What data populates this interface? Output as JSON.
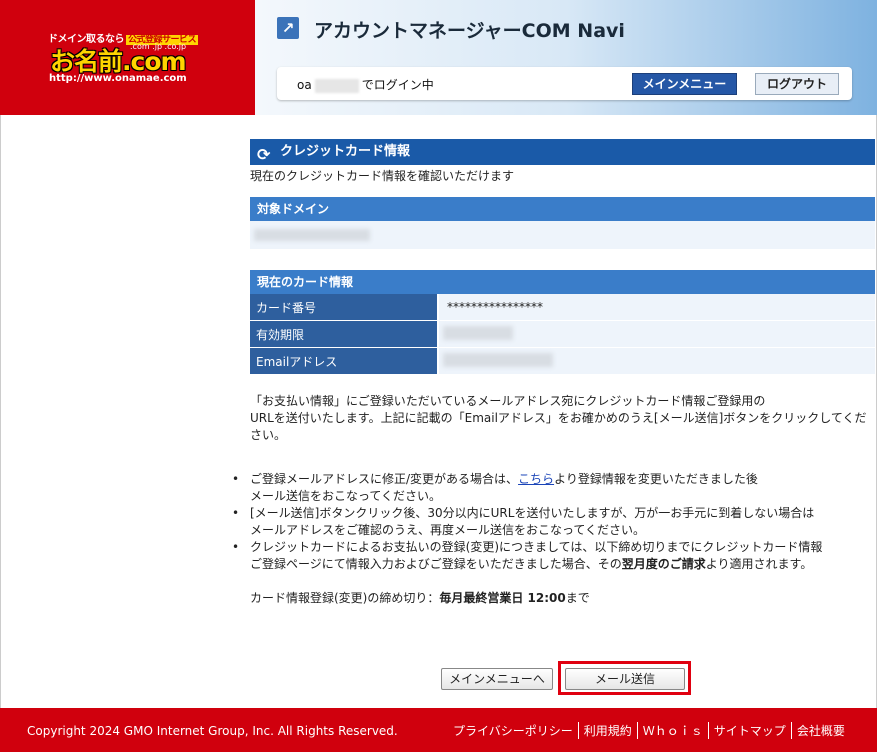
{
  "header": {
    "logo_tag": "ドメイン取るなら",
    "logo_badge": "公式登録サービス",
    "logo_main": "お名前.com",
    "logo_tlds": ".com .jp .co.jp",
    "logo_url": "http://www.onamae.com",
    "app_title": "アカウントマネージャーCOM Navi",
    "login_prefix": "oa",
    "login_suffix": "でログイン中",
    "main_menu_label": "メインメニュー",
    "logout_label": "ログアウト"
  },
  "main": {
    "section_title": "クレジットカード情報",
    "section_desc": "現在のクレジットカード情報を確認いただけます",
    "target_domain_label": "対象ドメイン",
    "card_info_label": "現在のカード情報",
    "card_rows": [
      {
        "key": "カード番号",
        "value": "****************"
      },
      {
        "key": "有効期限",
        "value": ""
      },
      {
        "key": "Emailアドレス",
        "value": ""
      }
    ],
    "info_line1": "「お支払い情報」にご登録いただいているメールアドレス宛にクレジットカード情報ご登録用の",
    "info_line2": "URLを送付いたします。上記に記載の「Emailアドレス」をお確かめのうえ[メール送信]ボタンをクリックしてください。",
    "note1_pre": "ご登録メールアドレスに修正/変更がある場合は、",
    "note1_link": "こちら",
    "note1_post": "より登録情報を変更いただきました後",
    "note1_line2": "メール送信をおこなってください。",
    "note2_line1": "[メール送信]ボタンクリック後、30分以内にURLを送付いたしますが、万が一お手元に到着しない場合は",
    "note2_line2": "メールアドレスをご確認のうえ、再度メール送信をおこなってください。",
    "note3_line1": "クレジットカードによるお支払いの登録(変更)につきましては、以下締め切りまでにクレジットカード情報",
    "note3_line2_pre": "ご登録ページにて情報入力およびご登録をいただきました場合、その",
    "note3_bold": "翌月度のご請求",
    "note3_post": "より適用されます。",
    "deadline_label": "カード情報登録(変更)の締め切り：",
    "deadline_value": "毎月最終営業日 12:00",
    "deadline_suffix": "まで",
    "btn_back": "メインメニューへ",
    "btn_send": "メール送信"
  },
  "footer": {
    "copyright": "Copyright 2024 GMO Internet Group, Inc. All Rights Reserved.",
    "links": [
      "プライバシーポリシー",
      "利用規約",
      "Ｗｈｏｉｓ",
      "サイトマップ",
      "会社概要"
    ]
  },
  "colors": {
    "brand_red": "#d0000d",
    "header_blue": "#1a5aa8",
    "highlight": "#e00010"
  }
}
